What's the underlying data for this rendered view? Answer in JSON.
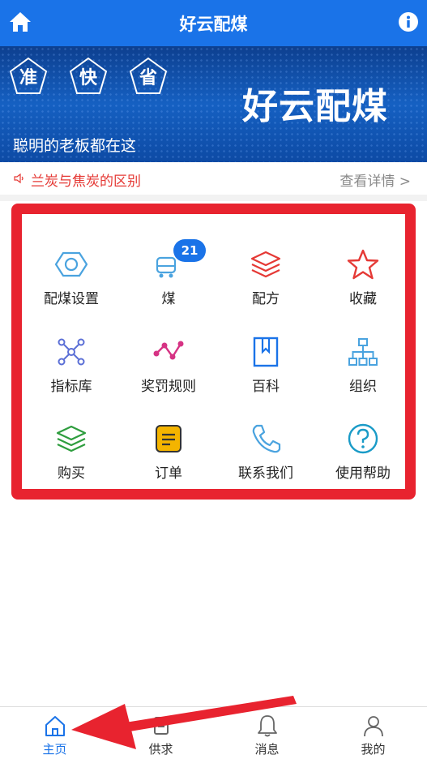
{
  "header": {
    "title": "好云配煤"
  },
  "banner": {
    "badges": [
      "准",
      "快",
      "省"
    ],
    "brand": "好云配煤",
    "slogan": "聪明的老板都在这"
  },
  "notice": {
    "text": "兰炭与焦炭的区别",
    "more": "查看详情 >"
  },
  "menu": {
    "items": [
      {
        "label": "配煤设置",
        "icon": "hexagon-nut-icon",
        "color": "#4aa3df"
      },
      {
        "label": "煤",
        "icon": "coal-cart-icon",
        "color": "#4aa3df",
        "badge": "21"
      },
      {
        "label": "配方",
        "icon": "layers-icon",
        "color": "#e53935"
      },
      {
        "label": "收藏",
        "icon": "star-icon",
        "color": "#e53935"
      },
      {
        "label": "指标库",
        "icon": "network-icon",
        "color": "#5b6fd6"
      },
      {
        "label": "奖罚规则",
        "icon": "trend-line-icon",
        "color": "#d63384"
      },
      {
        "label": "百科",
        "icon": "book-icon",
        "color": "#1a73e8"
      },
      {
        "label": "组织",
        "icon": "org-chart-icon",
        "color": "#4aa3df"
      },
      {
        "label": "购买",
        "icon": "stack-icon",
        "color": "#2e9d3e"
      },
      {
        "label": "订单",
        "icon": "order-note-icon",
        "color": "#f4b400"
      },
      {
        "label": "联系我们",
        "icon": "phone-icon",
        "color": "#4aa3df"
      },
      {
        "label": "使用帮助",
        "icon": "help-icon",
        "color": "#1a9bc7"
      }
    ]
  },
  "tabs": [
    {
      "label": "主页",
      "icon": "home-icon",
      "active": true
    },
    {
      "label": "供求",
      "icon": "supply-icon"
    },
    {
      "label": "消息",
      "icon": "bell-icon"
    },
    {
      "label": "我的",
      "icon": "user-icon"
    }
  ],
  "colors": {
    "primary": "#1a73e8",
    "highlight": "#e8232f"
  }
}
